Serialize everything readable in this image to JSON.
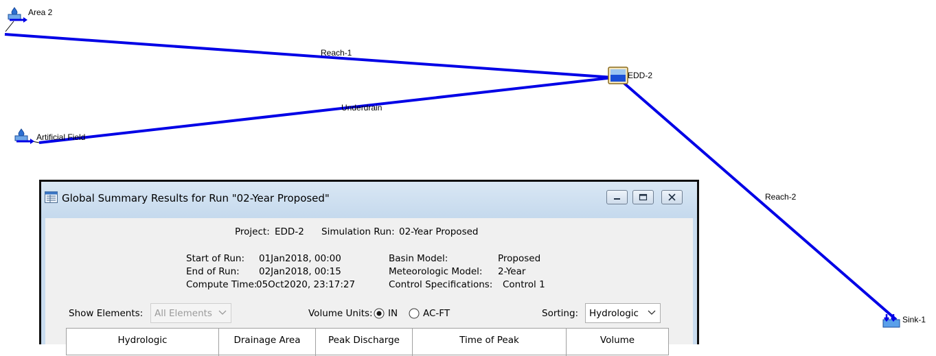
{
  "basin_map": {
    "elements": [
      {
        "id": "area2",
        "label": "Area 2",
        "icon": "subbasin-icon"
      },
      {
        "id": "artificial_field",
        "label": "Artificial Field",
        "icon": "subbasin-icon"
      },
      {
        "id": "edd2",
        "label": "EDD-2",
        "icon": "reservoir-icon"
      },
      {
        "id": "sink1",
        "label": "Sink-1",
        "icon": "sink-icon"
      }
    ],
    "reaches": [
      {
        "id": "reach1",
        "label": "Reach-1"
      },
      {
        "id": "underdrain",
        "label": "Underdrain"
      },
      {
        "id": "reach2",
        "label": "Reach-2"
      }
    ],
    "line_color": "#0000e6"
  },
  "dialog": {
    "title": "Global Summary Results for Run \"02-Year Proposed\"",
    "header": {
      "project_label": "Project:",
      "project_value": "EDD-2",
      "simulation_label": "Simulation Run:",
      "simulation_value": "02-Year Proposed"
    },
    "run_info": {
      "start_label": "Start of Run:",
      "start_value": "01Jan2018, 00:00",
      "end_label": "End of Run:",
      "end_value": "02Jan2018, 00:15",
      "compute_label": "Compute Time:",
      "compute_value": "05Oct2020, 23:17:27",
      "basin_label": "Basin Model:",
      "basin_value": "Proposed",
      "met_label": "Meteorologic Model:",
      "met_value": "2-Year",
      "control_label": "Control Specifications:",
      "control_value": "Control 1"
    },
    "controls": {
      "show_elements_label": "Show Elements:",
      "show_elements_value": "All Elements",
      "volume_units_label": "Volume Units:",
      "volume_options": [
        "IN",
        "AC-FT"
      ],
      "volume_selected": "IN",
      "sorting_label": "Sorting:",
      "sorting_value": "Hydrologic"
    },
    "table_columns": [
      "Hydrologic",
      "Drainage Area",
      "Peak Discharge",
      "Time of Peak",
      "Volume"
    ]
  }
}
